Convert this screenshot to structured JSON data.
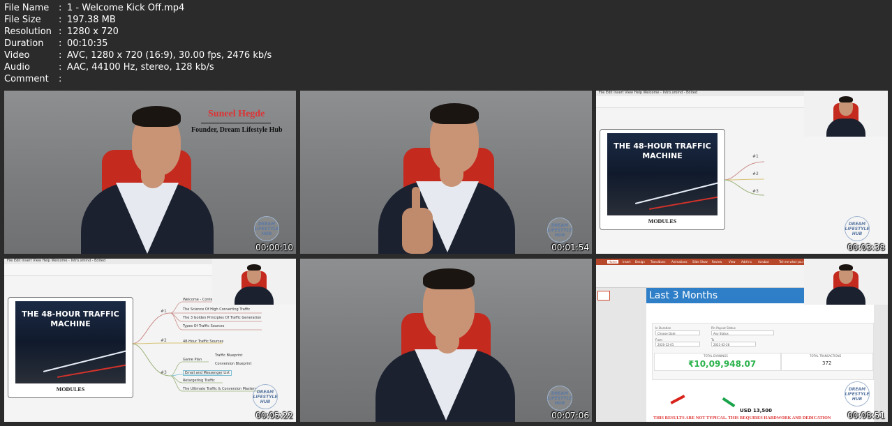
{
  "metadata": [
    {
      "key": "File Name",
      "value": "1 - Welcome Kick Off.mp4"
    },
    {
      "key": "File Size",
      "value": "197.38 MB"
    },
    {
      "key": "Resolution",
      "value": "1280 x 720"
    },
    {
      "key": "Duration",
      "value": "00:10:35"
    },
    {
      "key": "Video",
      "value": "AVC, 1280 x 720 (16:9), 30.00 fps, 2476 kb/s"
    },
    {
      "key": "Audio",
      "value": "AAC, 44100 Hz, stereo, 128 kb/s"
    },
    {
      "key": "Comment",
      "value": ""
    }
  ],
  "separator": ":",
  "thumbnails": [
    {
      "timestamp": "00:00:10",
      "name_plate": "Suneel Hegde",
      "role_plate": "Founder, Dream Lifestyle Hub"
    },
    {
      "timestamp": "00:01:54"
    },
    {
      "timestamp": "00:03:38"
    },
    {
      "timestamp": "00:05:22"
    },
    {
      "timestamp": "00:07:06"
    },
    {
      "timestamp": "00:08:51"
    }
  ],
  "watermark_text": "DREAM LIFESTYLE HUB",
  "mindmap": {
    "menubar": "File  Edit  Insert  View  Help  Welcome - Intro.xmind - Edited",
    "image_title": "THE 48-HOUR TRAFFIC MACHINE",
    "modules_label": "MODULES",
    "branches": [
      "#1",
      "#2",
      "#3"
    ],
    "nodes_1": [
      "Welcome - Content Strategy",
      "The Science Of High Converting Traffic",
      "The 3 Golden Principles Of Traffic Generation",
      "Types Of Traffic Sources"
    ],
    "nodes_2": [
      "48-Hour Traffic Sources"
    ],
    "nodes_3": [
      "Game Plan",
      "Traffic Blueprint",
      "Conversion Blueprint",
      "Email and Messenger List",
      "Retargeting Traffic",
      "The Ultimate Traffic & Conversion Mastery"
    ]
  },
  "ppt": {
    "tabs": [
      "Home",
      "Insert",
      "Design",
      "Transitions",
      "Animations",
      "Slide Show",
      "Review",
      "View",
      "Add-ins",
      "Acrobat",
      "Tell me what you want to do"
    ],
    "slide_title": "Last 3 Months",
    "filter_labels": [
      "In Duration",
      "Pin Payout Status",
      "From",
      "To"
    ],
    "filter_values": [
      "Choose Date",
      "Any Status",
      "2020-12-01",
      "2021-02-28"
    ],
    "col_total_earnings": "TOTAL EARNINGS",
    "col_total_transactions": "TOTAL TRANSACTIONS",
    "earnings": "₹10,09,948.07",
    "transactions": "372",
    "usd": "USD 13,500",
    "disclaimer": "THIS RESULTS ARE NOT TYPICAL. THIS REQUIRES HARDWORK AND DEDICATION"
  },
  "colors": {
    "background": "#2b2b2b",
    "chair": "#c52a1f",
    "slide_header": "#2f7fc8",
    "earnings_green": "#2bb24c"
  }
}
